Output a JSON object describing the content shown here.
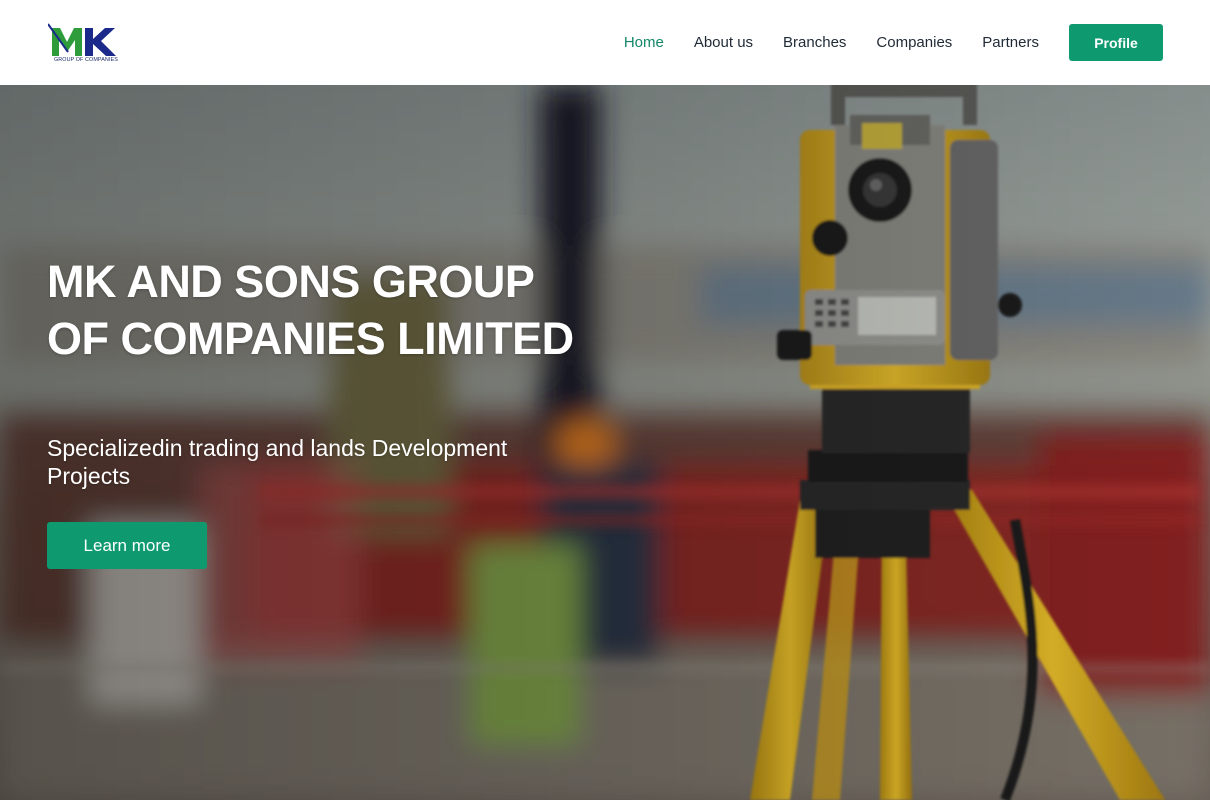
{
  "brand": {
    "logo_letters": "MK",
    "logo_subtitle": "GROUP OF COMPANIES",
    "colors": {
      "green": "#2e9c3a",
      "navy": "#1b2a8a"
    }
  },
  "nav": {
    "items": [
      {
        "label": "Home",
        "active": true
      },
      {
        "label": "About us",
        "active": false
      },
      {
        "label": "Branches",
        "active": false
      },
      {
        "label": "Companies",
        "active": false
      },
      {
        "label": "Partners",
        "active": false
      }
    ],
    "profile_label": "Profile"
  },
  "hero": {
    "title": "MK AND SONS GROUP OF COMPANIES LIMITED",
    "subtitle": "Specializedin trading and lands Development Projects",
    "cta_label": "Learn more",
    "background": "construction-site-surveying-instrument-photo"
  },
  "colors": {
    "accent": "#0e9a6e",
    "active_nav": "#14876a",
    "nav_text": "#1f2a36"
  }
}
